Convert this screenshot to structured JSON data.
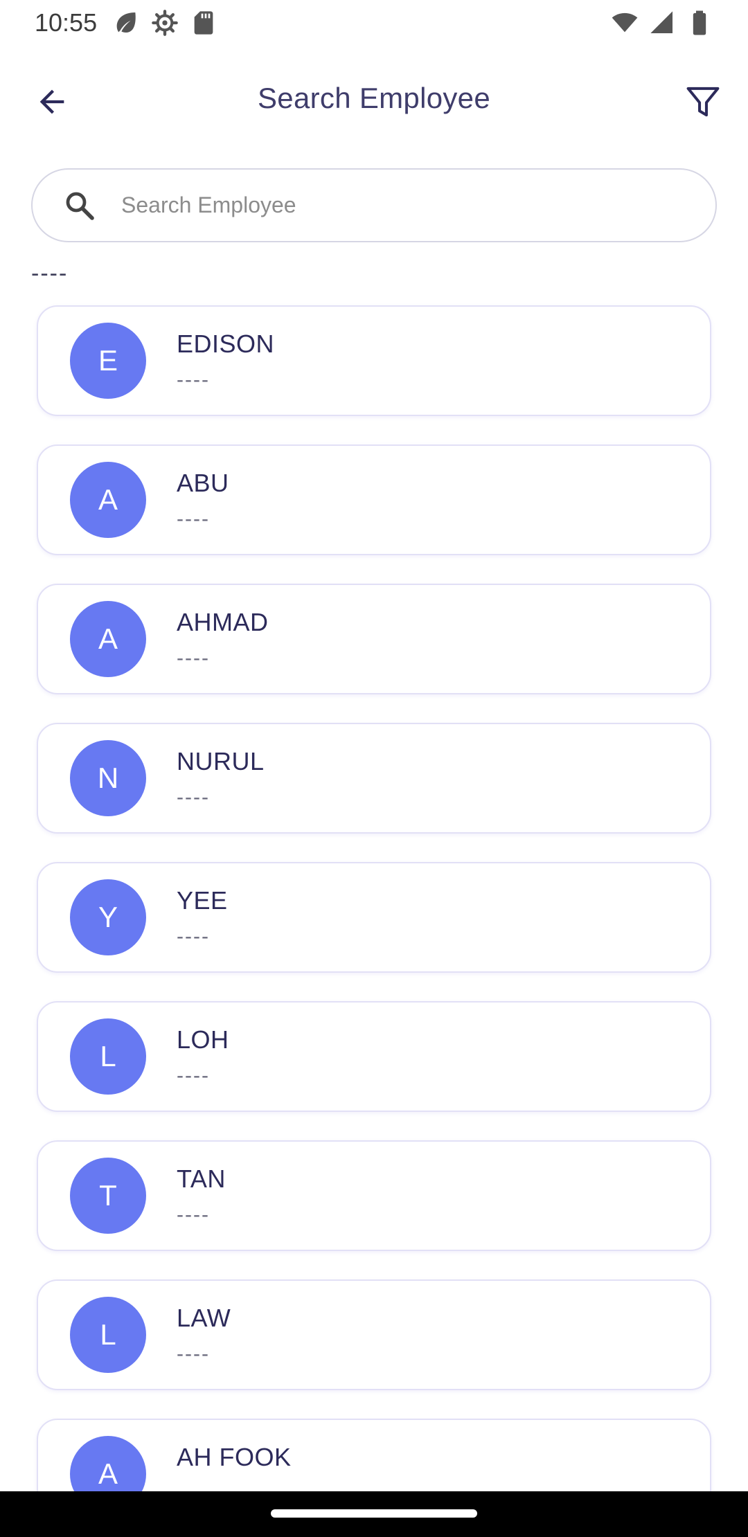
{
  "status_bar": {
    "time": "10:55",
    "left_icons": [
      "leaf-icon",
      "gear-icon",
      "sd-card-icon"
    ],
    "right_icons": [
      "wifi-icon",
      "signal-icon",
      "battery-icon"
    ]
  },
  "app_bar": {
    "title": "Search Employee",
    "back_icon": "arrow-left-icon",
    "filter_icon": "filter-icon"
  },
  "search": {
    "placeholder": "Search Employee",
    "value": ""
  },
  "section_label": "----",
  "employees": [
    {
      "initial": "E",
      "name": "EDISON",
      "sub": "----"
    },
    {
      "initial": "A",
      "name": "ABU",
      "sub": "----"
    },
    {
      "initial": "A",
      "name": "AHMAD",
      "sub": "----"
    },
    {
      "initial": "N",
      "name": "NURUL",
      "sub": "----"
    },
    {
      "initial": "Y",
      "name": "YEE",
      "sub": "----"
    },
    {
      "initial": "L",
      "name": "LOH",
      "sub": "----"
    },
    {
      "initial": "T",
      "name": "TAN",
      "sub": "----"
    },
    {
      "initial": "L",
      "name": "LAW",
      "sub": "----"
    },
    {
      "initial": "A",
      "name": "AH FOOK",
      "sub": "----"
    }
  ],
  "colors": {
    "accent": "#6779f2",
    "title": "#3f3d6b",
    "name": "#2c2a5a",
    "card_border": "#e2e0f6"
  }
}
